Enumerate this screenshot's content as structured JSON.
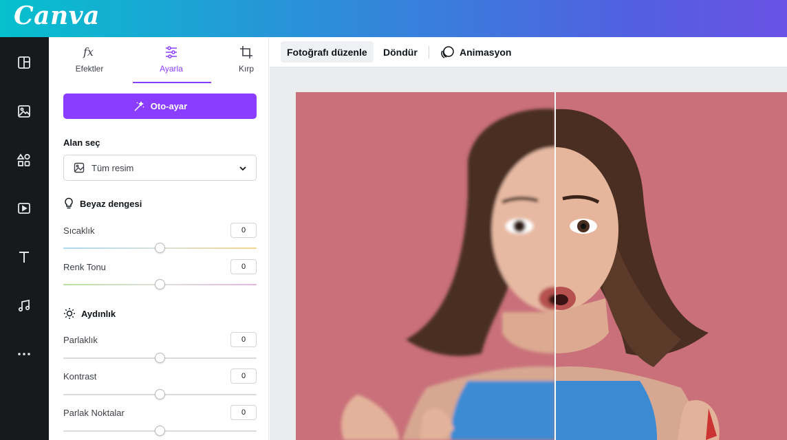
{
  "app": {
    "logo": "Canva"
  },
  "rail": {
    "items": [
      {
        "icon": "layout-icon"
      },
      {
        "icon": "image-icon"
      },
      {
        "icon": "elements-icon"
      },
      {
        "icon": "video-icon"
      },
      {
        "icon": "text-icon"
      },
      {
        "icon": "audio-icon"
      },
      {
        "icon": "more-icon"
      }
    ]
  },
  "panel": {
    "tabs": [
      {
        "label": "Efektler",
        "icon": "fx-icon",
        "active": false
      },
      {
        "label": "Ayarla",
        "icon": "sliders-icon",
        "active": true
      },
      {
        "label": "Kırp",
        "icon": "crop-icon",
        "active": false
      }
    ],
    "auto_button": "Oto-ayar",
    "area_label": "Alan seç",
    "area_select": {
      "value": "Tüm resim"
    },
    "white_balance": {
      "title": "Beyaz dengesi",
      "sliders": [
        {
          "label": "Sıcaklık",
          "value": "0",
          "position": 0.5
        },
        {
          "label": "Renk Tonu",
          "value": "0",
          "position": 0.5
        }
      ]
    },
    "light": {
      "title": "Aydınlık",
      "sliders": [
        {
          "label": "Parlaklık",
          "value": "0",
          "position": 0.5
        },
        {
          "label": "Kontrast",
          "value": "0",
          "position": 0.5
        },
        {
          "label": "Parlak Noktalar",
          "value": "0",
          "position": 0.5
        }
      ]
    }
  },
  "toolbar": {
    "edit_photo": "Fotoğrafı düzenle",
    "rotate": "Döndür",
    "animate": "Animasyon"
  },
  "colors": {
    "accent": "#8b3dff",
    "rail_bg": "#18191b",
    "photo_bg": "#c9707a"
  }
}
